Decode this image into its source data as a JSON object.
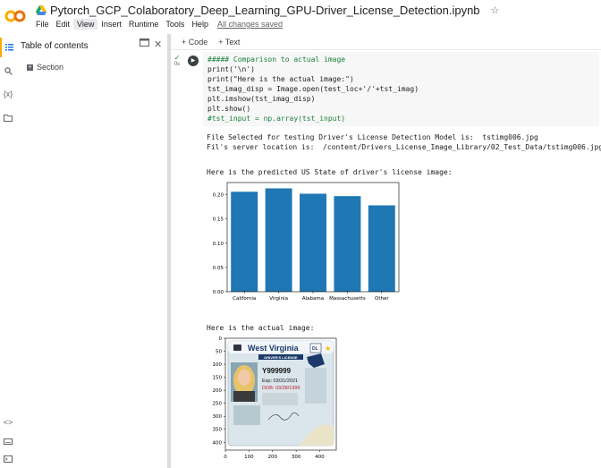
{
  "app": {
    "logo_text": "CO",
    "notebook_title": "Pytorch_GCP_Colaboratory_Deep_Learning_GPU-Driver_License_Detection.ipynb",
    "menu": [
      "File",
      "Edit",
      "View",
      "Insert",
      "Runtime",
      "Tools",
      "Help"
    ],
    "saved_status": "All changes saved"
  },
  "rail": {
    "items": [
      "toc-icon",
      "search-icon",
      "variables-icon",
      "folder-icon"
    ],
    "variables_label": "{x}",
    "bottom_items": [
      "code-icon",
      "keyboard-icon",
      "terminal-icon"
    ]
  },
  "toc": {
    "title": "Table of contents",
    "section": "Section"
  },
  "toolbar": {
    "code_label": "+ Code",
    "text_label": "+ Text"
  },
  "cell": {
    "exec_count": "0s",
    "lines": [
      "##### Comparison to actual image",
      "print('\\n')",
      "print(\"Here is the actual image:\")",
      "tst_imag_disp = Image.open(test_loc+'/'+tst_imag)",
      "plt.imshow(tst_imag_disp)",
      "plt.show()",
      "#tst_input = np.array(tst_input)"
    ]
  },
  "output": {
    "line1": "File Selected for testing Driver's License Detection Model is:  tstimg006.jpg",
    "line2": "Fil's server location is:  /content/Drivers_License_Image_Library/02_Test_Data/tstimg006.jpg",
    "line3": "Here is the predicted US State of driver's license image:",
    "line4": "Here is the actual image:"
  },
  "chart_data": [
    {
      "type": "bar",
      "categories": [
        "California",
        "Virginia",
        "Alabama",
        "Massachusetts",
        "Other"
      ],
      "values": [
        0.206,
        0.213,
        0.202,
        0.197,
        0.178
      ],
      "yticks": [
        "0.00",
        "0.05",
        "0.10",
        "0.15",
        "0.20"
      ],
      "ylim": [
        0,
        0.225
      ],
      "color": "#1f77b4"
    },
    {
      "type": "image",
      "xticks": [
        "0",
        "100",
        "200",
        "300",
        "400"
      ],
      "yticks": [
        "0",
        "50",
        "100",
        "150",
        "200",
        "250",
        "300",
        "350",
        "400"
      ],
      "xlim": [
        0,
        470
      ],
      "ylim": [
        0,
        430
      ],
      "card": {
        "state": "West Virginia",
        "subtitle": "DRIVER'S LICENSE",
        "number": "Y999999",
        "exp": "Exp: 03/31/2021",
        "dob": "DOB: 03/28/1996",
        "dl": "DL"
      }
    }
  ]
}
